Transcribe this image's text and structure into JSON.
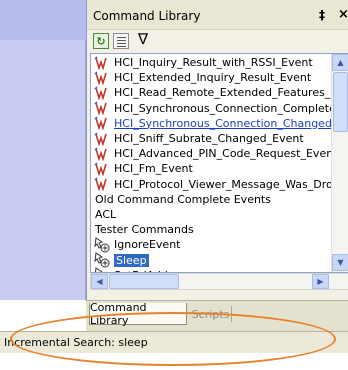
{
  "panel": {
    "title": "Command Library",
    "pin_glyph": "‡",
    "close_glyph": "×"
  },
  "toolbar": {
    "refresh_glyph": "↻",
    "filter_glyph": "∇"
  },
  "list": {
    "items": [
      {
        "label": "HCI_Inquiry_Result_with_RSSI_Event",
        "kind": "event"
      },
      {
        "label": "HCI_Extended_Inquiry_Result_Event",
        "kind": "event"
      },
      {
        "label": "HCI_Read_Remote_Extended_Features_Comp",
        "kind": "event"
      },
      {
        "label": "HCI_Synchronous_Connection_Complete_Eve",
        "kind": "event"
      },
      {
        "label": "HCI_Synchronous_Connection_Changed_Ever",
        "kind": "event-linked"
      },
      {
        "label": "HCI_Sniff_Subrate_Changed_Event",
        "kind": "event"
      },
      {
        "label": "HCI_Advanced_PIN_Code_Request_Event",
        "kind": "event"
      },
      {
        "label": "HCI_Fm_Event",
        "kind": "event"
      },
      {
        "label": "HCI_Protocol_Viewer_Message_Was_Dropped",
        "kind": "event"
      },
      {
        "label": "Old Command Complete Events",
        "kind": "group"
      },
      {
        "label": "ACL",
        "kind": "group"
      },
      {
        "label": "Tester Commands",
        "kind": "group"
      },
      {
        "label": "IgnoreEvent",
        "kind": "command"
      },
      {
        "label": "Sleep",
        "kind": "command-selected"
      },
      {
        "label": "SetBdAddr",
        "kind": "command"
      }
    ]
  },
  "scroll": {
    "up_glyph": "▲",
    "down_glyph": "▼",
    "left_glyph": "◀",
    "right_glyph": "▶"
  },
  "tabs": {
    "active": "Command Library",
    "inactive": "Scripts"
  },
  "status": {
    "text": "Incremental Search: sleep"
  },
  "colors": {
    "accent_highlight": "#e8822a",
    "selection": "#316ac5",
    "link": "#1b3fbf"
  }
}
